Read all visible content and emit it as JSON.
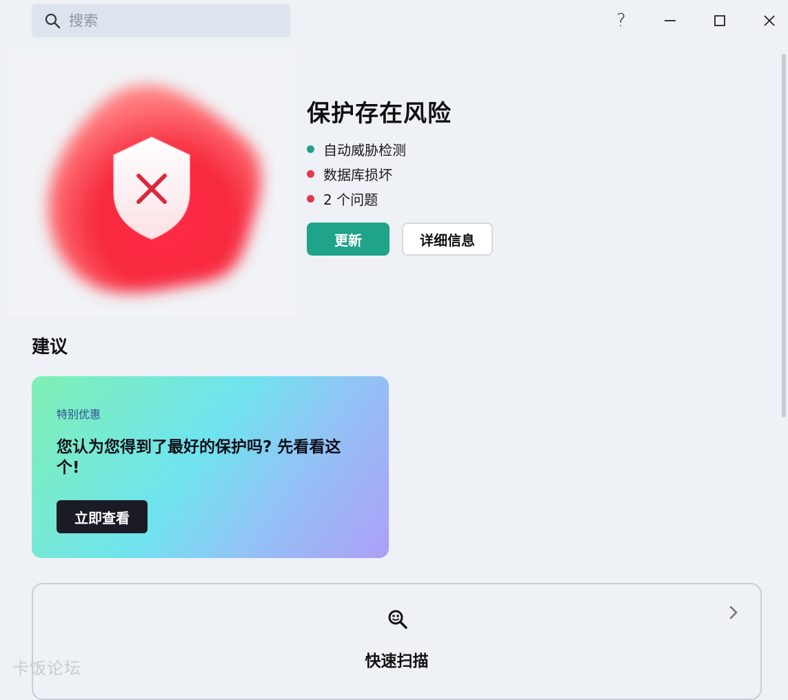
{
  "search": {
    "placeholder": "搜索",
    "icon": "search-icon"
  },
  "window_controls": {
    "help": "?",
    "help_icon": "help-icon",
    "minimize_icon": "minimize-icon",
    "maximize_icon": "maximize-icon",
    "close_icon": "close-icon"
  },
  "status": {
    "title": "保护存在风险",
    "icon": "shield-error-icon",
    "items": [
      {
        "label": "自动威胁检测",
        "color": "#1fa38a"
      },
      {
        "label": "数据库损坏",
        "color": "#e03a4a"
      },
      {
        "label": "2 个问题",
        "color": "#e03a4a"
      }
    ],
    "update_label": "更新",
    "details_label": "详细信息"
  },
  "recommendations": {
    "title": "建议",
    "promo": {
      "eyebrow": "特别优惠",
      "headline": "您认为您得到了最好的保护吗? 先看看这个!",
      "button_label": "立即查看"
    }
  },
  "quick_scan": {
    "label": "快速扫描",
    "icon": "scan-icon"
  },
  "watermark": "卡饭论坛",
  "colors": {
    "accent": "#1fa38a",
    "danger": "#e03a4a",
    "background": "#eef1f6"
  }
}
